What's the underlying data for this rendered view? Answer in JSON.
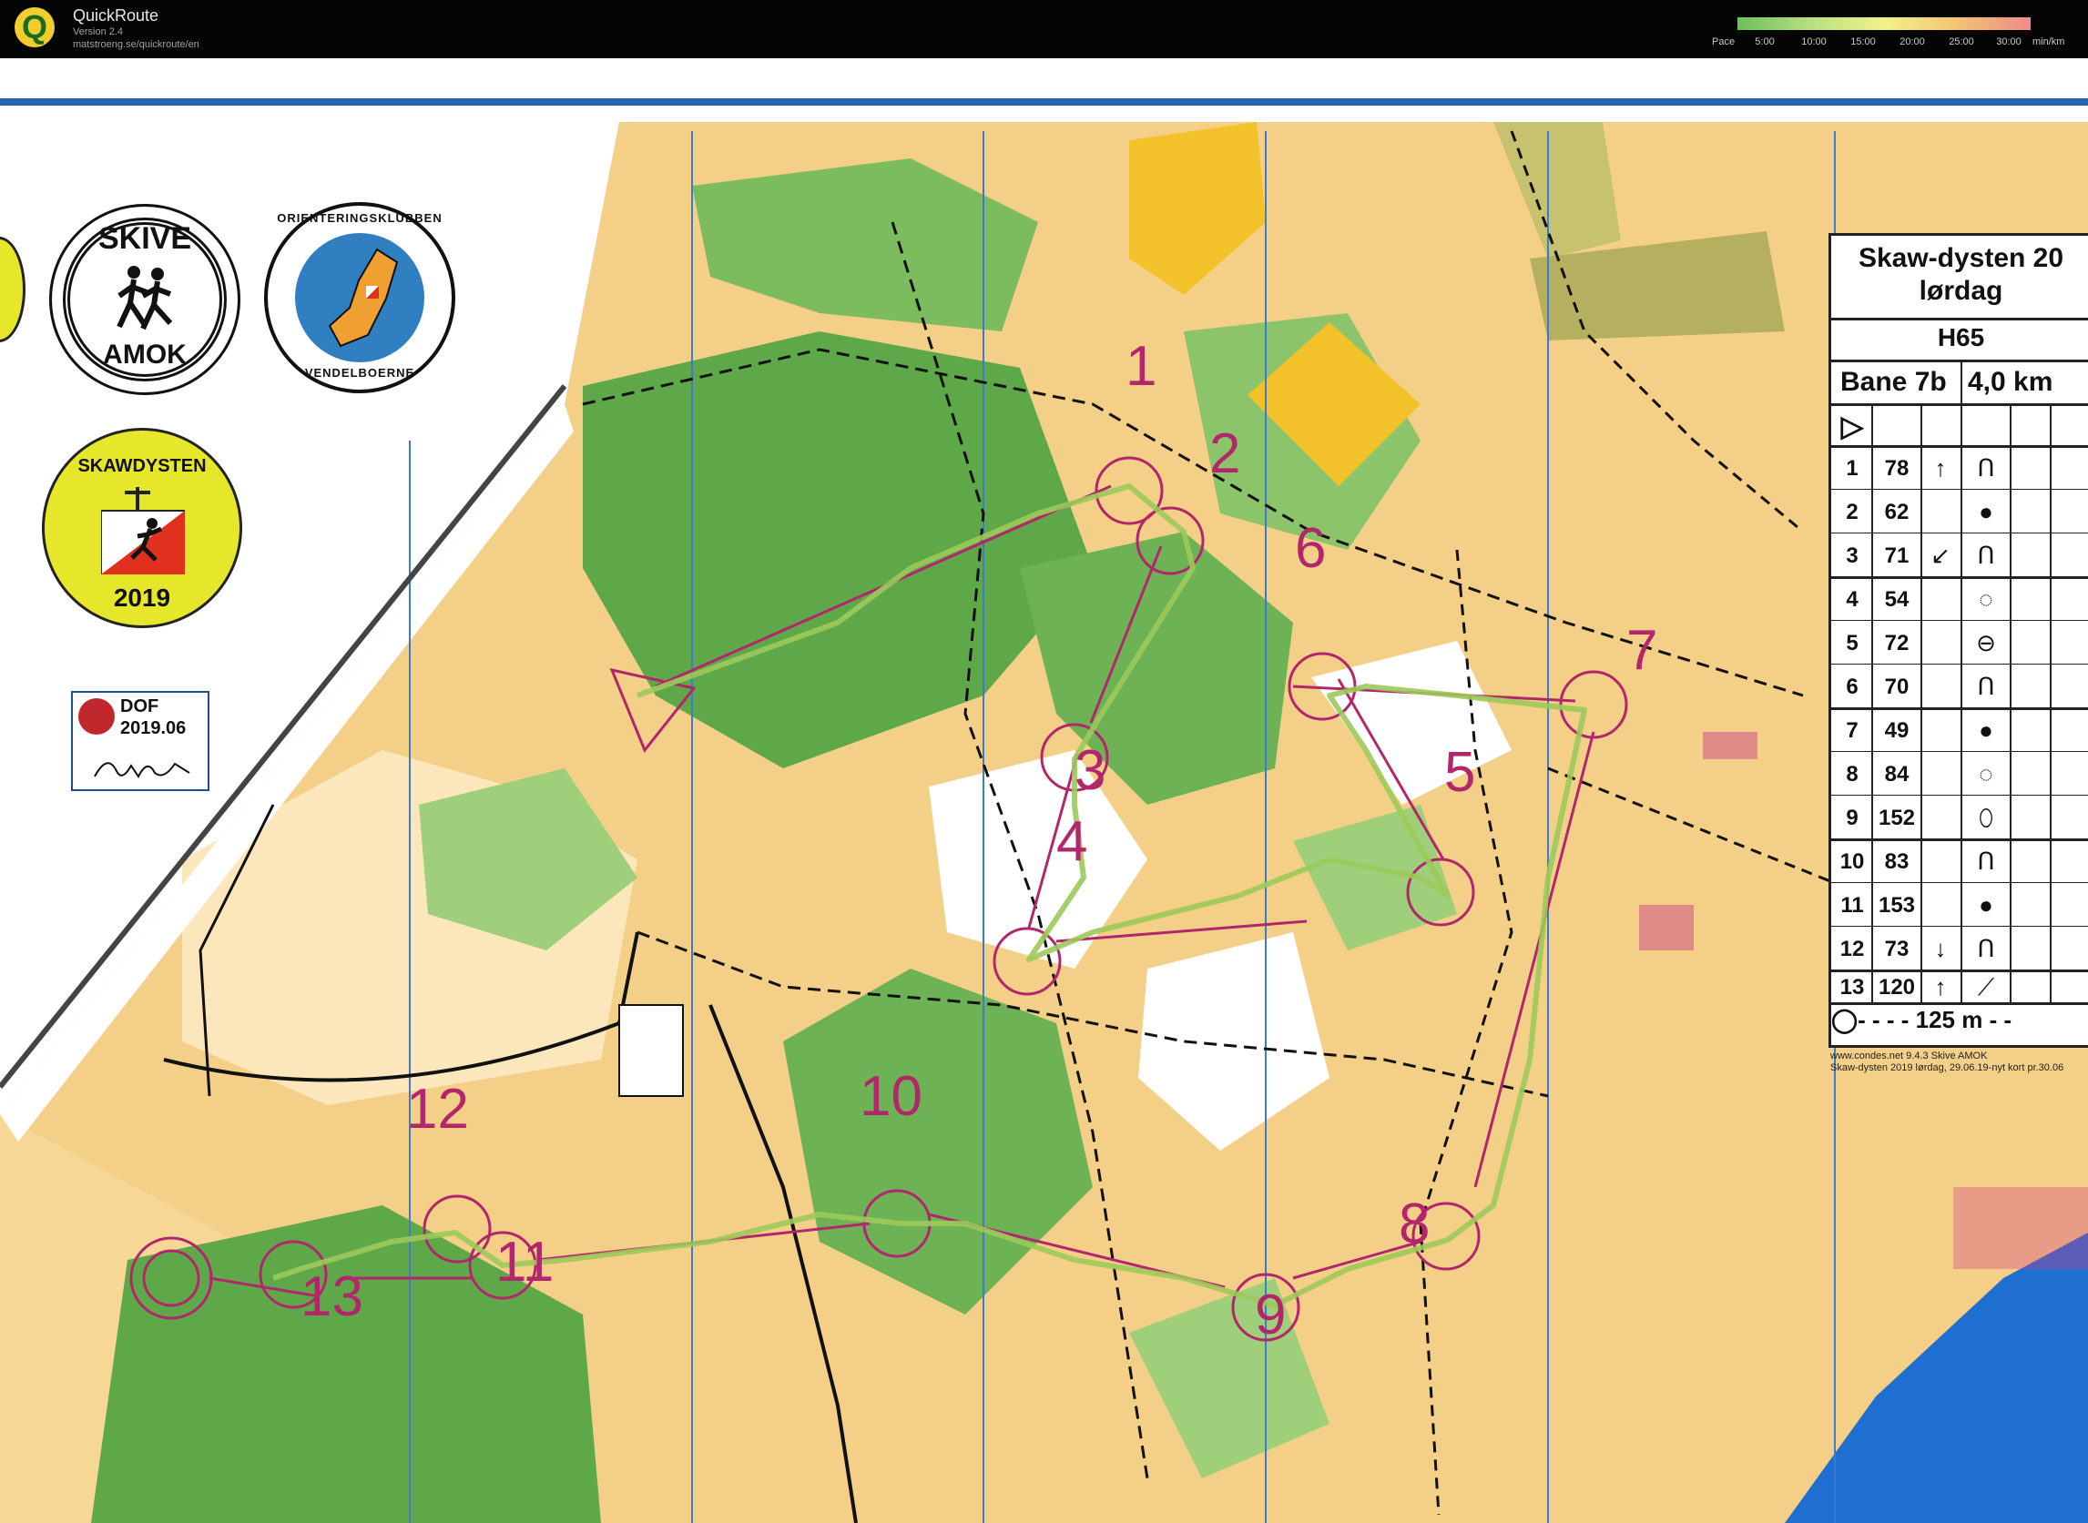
{
  "app": {
    "name": "QuickRoute",
    "version": "Version 2.4",
    "url": "matstroeng.se/quickroute/en",
    "logo_letter": "Q"
  },
  "pace_legend": {
    "label": "Pace",
    "ticks": [
      "5:00",
      "10:00",
      "15:00",
      "20:00",
      "25:00",
      "30:00"
    ],
    "unit": "min/km"
  },
  "logos": {
    "skive_top": "SKIVE",
    "skive_bottom": "AMOK",
    "club_top": "ORIENTERINGSKLUBBEN",
    "club_bottom": "VENDELBOERNE",
    "event_name": "SKAWDYSTEN",
    "event_year": "2019",
    "dof_line1": "DOF",
    "dof_line2": "2019.06"
  },
  "control_description": {
    "title_line1": "Skaw-dysten 20",
    "title_line2": "lørdag",
    "class": "H65",
    "course": "Bane 7b",
    "length": "4,0 km",
    "start_symbol": "▷",
    "rows": [
      {
        "num": "1",
        "code": "78",
        "dir": "↑",
        "sym": "ᑎ"
      },
      {
        "num": "2",
        "code": "62",
        "dir": "",
        "sym": "●"
      },
      {
        "num": "3",
        "code": "71",
        "dir": "↙",
        "sym": "ᑎ"
      },
      {
        "num": "4",
        "code": "54",
        "dir": "",
        "sym": "◌"
      },
      {
        "num": "5",
        "code": "72",
        "dir": "",
        "sym": "⊖"
      },
      {
        "num": "6",
        "code": "70",
        "dir": "",
        "sym": "ᑎ"
      },
      {
        "num": "7",
        "code": "49",
        "dir": "",
        "sym": "●"
      },
      {
        "num": "8",
        "code": "84",
        "dir": "",
        "sym": "◌"
      },
      {
        "num": "9",
        "code": "152",
        "dir": "",
        "sym": "⬯"
      },
      {
        "num": "10",
        "code": "83",
        "dir": "",
        "sym": "ᑎ"
      },
      {
        "num": "11",
        "code": "153",
        "dir": "",
        "sym": "●"
      },
      {
        "num": "12",
        "code": "73",
        "dir": "↓",
        "sym": "ᑎ"
      },
      {
        "num": "13",
        "code": "120",
        "dir": "↑",
        "sym": "⟋"
      }
    ],
    "finish_text": "◯- - - - 125 m - -",
    "footer1": "www.condes.net 9.4.3 Skive AMOK",
    "footer2": "Skaw-dysten 2019 lørdag, 29.06.19-nyt kort pr.30.06"
  },
  "course": {
    "color": "#b2276c",
    "control_labels": [
      "1",
      "2",
      "3",
      "4",
      "5",
      "6",
      "7",
      "8",
      "9",
      "10",
      "11",
      "12",
      "13"
    ]
  },
  "colors": {
    "forest_green": "#5fa84a",
    "light_green": "#9fcf7a",
    "open_land": "#f4cf87",
    "rough_open": "#fbe7bb",
    "yellow_field": "#f3c12a",
    "water": "#1f6fd1",
    "route_green": "#9cc95a"
  }
}
